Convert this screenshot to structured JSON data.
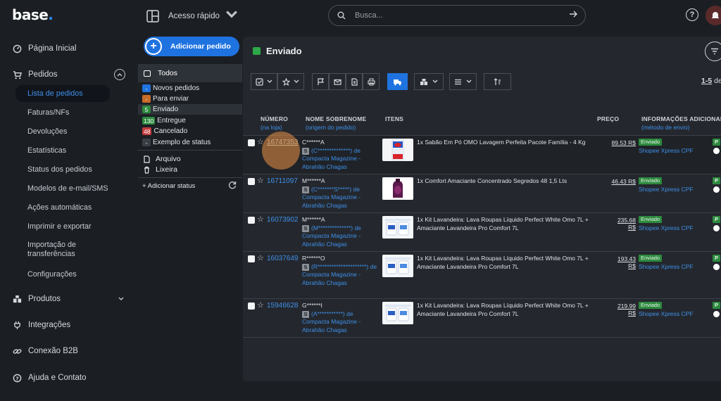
{
  "app": {
    "logo": "base",
    "logo_dot": "."
  },
  "sidebar": {
    "items": [
      {
        "label": "Página Inicial",
        "icon": "gauge-icon"
      },
      {
        "label": "Pedidos",
        "icon": "cart-icon"
      },
      {
        "label": "Produtos",
        "icon": "boxes-icon"
      },
      {
        "label": "Integrações",
        "icon": "plug-icon"
      },
      {
        "label": "Conexão B2B",
        "icon": "link-icon"
      },
      {
        "label": "Ajuda e Contato",
        "icon": "help-circle-icon"
      }
    ],
    "pedidos_sub": [
      "Lista de pedidos",
      "Faturas/NFs",
      "Devoluções",
      "Estatísticas",
      "Status dos pedidos",
      "Modelos de e-mail/SMS",
      "Ações automáticas",
      "Imprimir e exportar",
      "Importação de transferências",
      "Configurações"
    ]
  },
  "topbar": {
    "quick_access": "Acesso rápido",
    "search_placeholder": "Busca..."
  },
  "filters": {
    "add_order": "Adicionar pedido",
    "all": "Todos",
    "statuses": [
      {
        "badge": "-",
        "label": "Novos pedidos",
        "color": "#1f73e0"
      },
      {
        "badge": "-",
        "label": "Para enviar",
        "color": "#c76b2a"
      },
      {
        "badge": "5",
        "label": "Enviado",
        "color": "#2d8a3e"
      },
      {
        "badge": "130",
        "label": "Entregue",
        "color": "#2d8a3e"
      },
      {
        "badge": "48",
        "label": "Cancelado",
        "color": "#c23b3b"
      },
      {
        "badge": "-",
        "label": "Exemplo de status",
        "color": "#3a3f46"
      }
    ],
    "archive": "Arquivo",
    "trash": "Lixeira",
    "add_status": "+ Adicionar status"
  },
  "panel": {
    "title": "Enviado",
    "status_color": "#2ea84a",
    "pager_range": "1-5",
    "pager_suffix": " de",
    "columns": {
      "number": "NÚMERO",
      "number_sub": "(na loja)",
      "name": "NOME SOBRENOME",
      "name_sub": "(origem do pedido)",
      "items": "ITENS",
      "price": "PREÇO",
      "info": "INFORMAÇÕES ADICIONAIS",
      "info_sub": "(método de envio)"
    }
  },
  "orders": [
    {
      "number": "16747353",
      "name": "C******A",
      "origin_code": "(C**************)",
      "origin_rest": "de Compacta Magazine - Abrahão Chagas",
      "item": "1x Sabão Em Pó OMO Lavagem Perfeita Pacote Família - 4 Kg",
      "price": "89.53 R$",
      "status": "Enviado",
      "shipping": "Shopee Xpress CPF",
      "flag": "P",
      "thumb": "detergent-box"
    },
    {
      "number": "16711097",
      "name": "M******A",
      "origin_code": "(C*******S*****)",
      "origin_rest": "de Compacta Magazine - Abrahão Chagas",
      "item": "1x Comfort Amaciante Concentrado Segredos 48 1,5 Lts",
      "price": "46.43 R$",
      "status": "Enviado",
      "shipping": "Shopee Xpress CPF",
      "flag": "P",
      "thumb": "softener-bottle"
    },
    {
      "number": "16073902",
      "name": "M******A",
      "origin_code": "(M**************)",
      "origin_rest": "de Compacta Magazine - Abrahão Chagas",
      "item": "1x Kit Lavandeira: Lava Roupas Líquido Perfect White Omo 7L + Amaciante Lavandeira Pro Comfort 7L",
      "price": "235.68 R$",
      "status": "Enviado",
      "shipping": "Shopee Xpress CPF",
      "flag": "P",
      "thumb": "kit-gallons"
    },
    {
      "number": "16037649",
      "name": "R******O",
      "origin_code": "(R*********************)",
      "origin_rest": "de Compacta Magazine - Abrahão Chagas",
      "item": "1x Kit Lavandeira: Lava Roupas Líquido Perfect White Omo 7L + Amaciante Lavandeira Pro Comfort 7L",
      "price": "193.43 R$",
      "status": "Enviado",
      "shipping": "Shopee Xpress CPF",
      "flag": "P",
      "thumb": "kit-gallons"
    },
    {
      "number": "15946628",
      "name": "G******I",
      "origin_code": "(A***********)",
      "origin_rest": "de Compacta Magazine - Abrahão Chagas",
      "item": "1x Kit Lavandeira: Lava Roupas Líquido Perfect White Omo 7L + Amaciante Lavandeira Pro Comfort 7L",
      "price": "219.99 R$",
      "status": "Enviado",
      "shipping": "Shopee Xpress CPF",
      "flag": "P",
      "thumb": "kit-gallons"
    }
  ]
}
